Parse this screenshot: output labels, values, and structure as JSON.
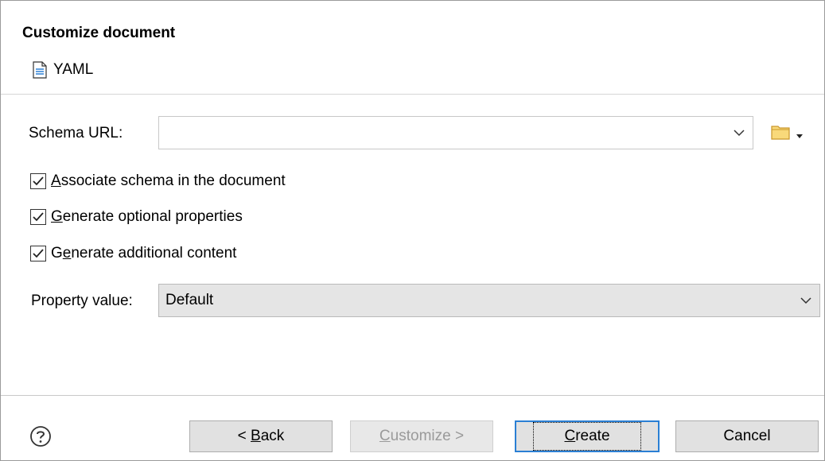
{
  "header": {
    "title": "Customize document",
    "doc_type": "YAML",
    "doc_icon": "document-icon"
  },
  "schema": {
    "label": "Schema URL:",
    "value": "",
    "folder_icon": "folder-icon"
  },
  "options": [
    {
      "pre": "",
      "mn": "A",
      "post": "ssociate schema in the document",
      "checked": true
    },
    {
      "pre": "",
      "mn": "G",
      "post": "enerate optional properties",
      "checked": true
    },
    {
      "pre": "G",
      "mn": "e",
      "post": "nerate additional content",
      "checked": true
    }
  ],
  "property_value": {
    "label": "Property value:",
    "selected": "Default"
  },
  "footer": {
    "help_icon": "help-icon",
    "back": {
      "pre": "< ",
      "mn": "B",
      "post": "ack"
    },
    "customize": {
      "pre": "",
      "mn": "C",
      "post": "ustomize >"
    },
    "create": {
      "pre": "",
      "mn": "C",
      "post": "reate"
    },
    "cancel": "Cancel"
  },
  "colors": {
    "primary_focus": "#2a7fd4",
    "folder": "#f2c14e"
  }
}
